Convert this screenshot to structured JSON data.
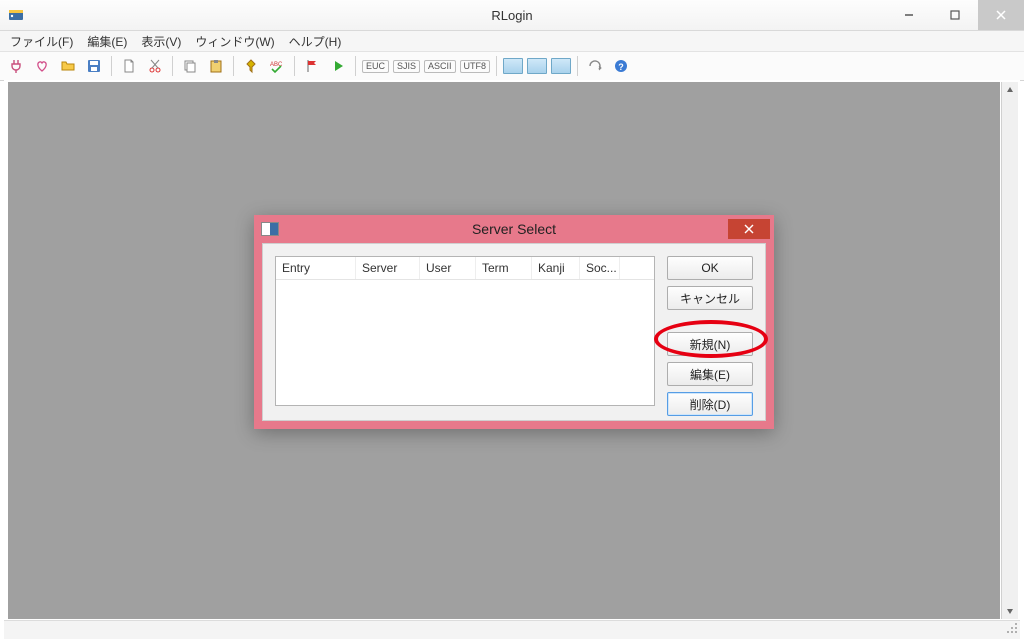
{
  "window": {
    "title": "RLogin"
  },
  "menu": {
    "file": "ファイル(F)",
    "edit": "編集(E)",
    "view": "表示(V)",
    "window": "ウィンドウ(W)",
    "help": "ヘルプ(H)"
  },
  "toolbar": {
    "enc_euc": "EUC",
    "enc_sjis": "SJIS",
    "enc_ascii": "ASCII",
    "enc_utf8": "UTF8"
  },
  "dialog": {
    "title": "Server Select",
    "columns": {
      "entry": "Entry",
      "server": "Server",
      "user": "User",
      "term": "Term",
      "kanji": "Kanji",
      "socket": "Soc..."
    },
    "buttons": {
      "ok": "OK",
      "cancel": "キャンセル",
      "new": "新規(N)",
      "edit": "編集(E)",
      "delete": "削除(D)"
    }
  }
}
